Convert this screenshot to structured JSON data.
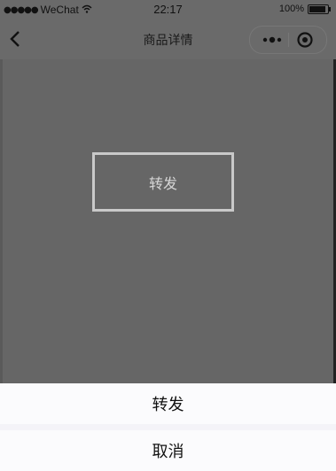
{
  "status_bar": {
    "signal_dots": "●●●●●",
    "carrier": "WeChat",
    "wifi_icon": "wifi-icon",
    "time": "22:17",
    "battery": "100%"
  },
  "nav": {
    "title": "商品详情",
    "back_icon": "chevron-left-icon",
    "more_icon": "more-dots-icon",
    "close_icon": "target-close-icon"
  },
  "content": {
    "forward_button_label": "转发"
  },
  "action_sheet": {
    "items": [
      {
        "label": "转发"
      }
    ],
    "cancel_label": "取消"
  },
  "colors": {
    "mask": "#666666",
    "sheet_bg": "#f4f3f8",
    "sheet_item_bg": "#fbfbfd"
  }
}
